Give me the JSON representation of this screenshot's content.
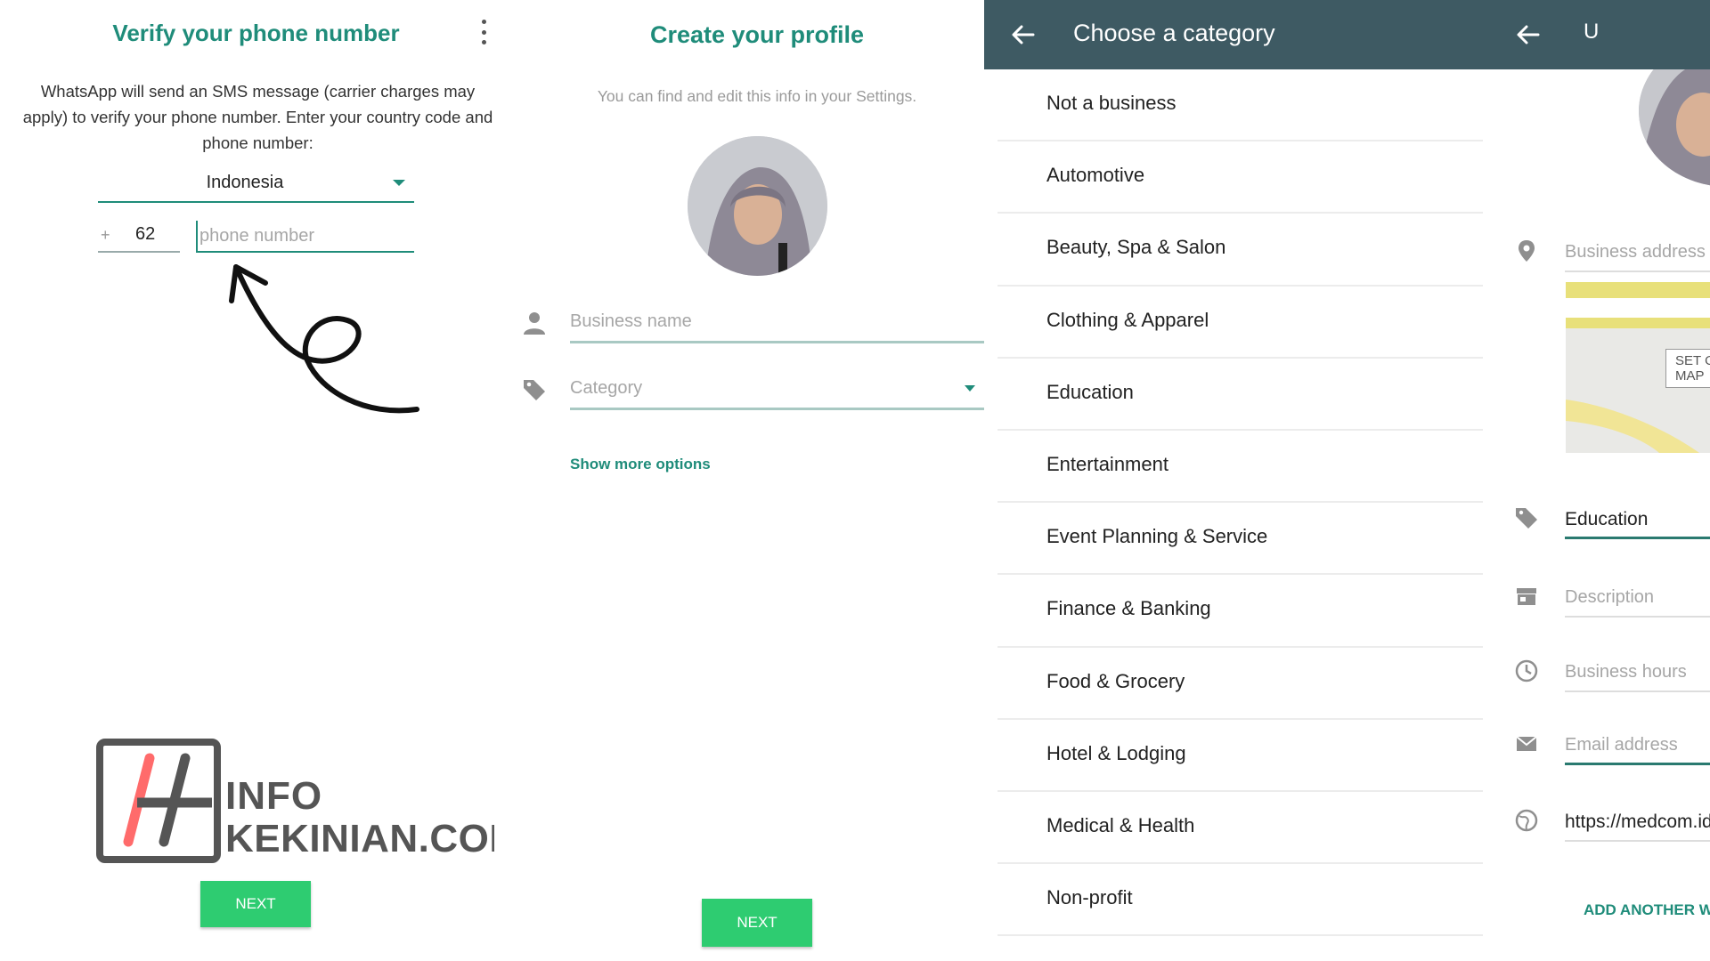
{
  "verify": {
    "title": "Verify your phone number",
    "description": "WhatsApp will send an SMS message (carrier charges may apply) to verify your phone number. Enter your country code and phone number:",
    "country": "Indonesia",
    "plus": "+",
    "country_code": "62",
    "phone_placeholder": "phone number",
    "next_label": "NEXT"
  },
  "watermark": {
    "line1": "INFO",
    "line2": "KEKINIAN.COM"
  },
  "profile": {
    "title": "Create your profile",
    "subtitle": "You can find and edit this info in your Settings.",
    "business_name_placeholder": "Business name",
    "category_placeholder": "Category",
    "show_more": "Show more options",
    "next_label": "NEXT"
  },
  "category": {
    "title": "Choose a category",
    "items": [
      "Not a business",
      "Automotive",
      "Beauty, Spa & Salon",
      "Clothing & Apparel",
      "Education",
      "Entertainment",
      "Event Planning & Service",
      "Finance & Banking",
      "Food & Grocery",
      "Hotel & Lodging",
      "Medical & Health",
      "Non-profit"
    ]
  },
  "details": {
    "title": "U",
    "address_placeholder": "Business address",
    "map_button": "SET ON MAP",
    "category_value": "Education",
    "description_placeholder": "Description",
    "hours_placeholder": "Business hours",
    "email_placeholder": "Email address",
    "website_value": "https://medcom.id",
    "add_another": "ADD ANOTHER WEBSITE"
  },
  "colors": {
    "accent": "#1f8c7a",
    "button": "#2ecc71",
    "toolbar": "#3e5a63"
  }
}
